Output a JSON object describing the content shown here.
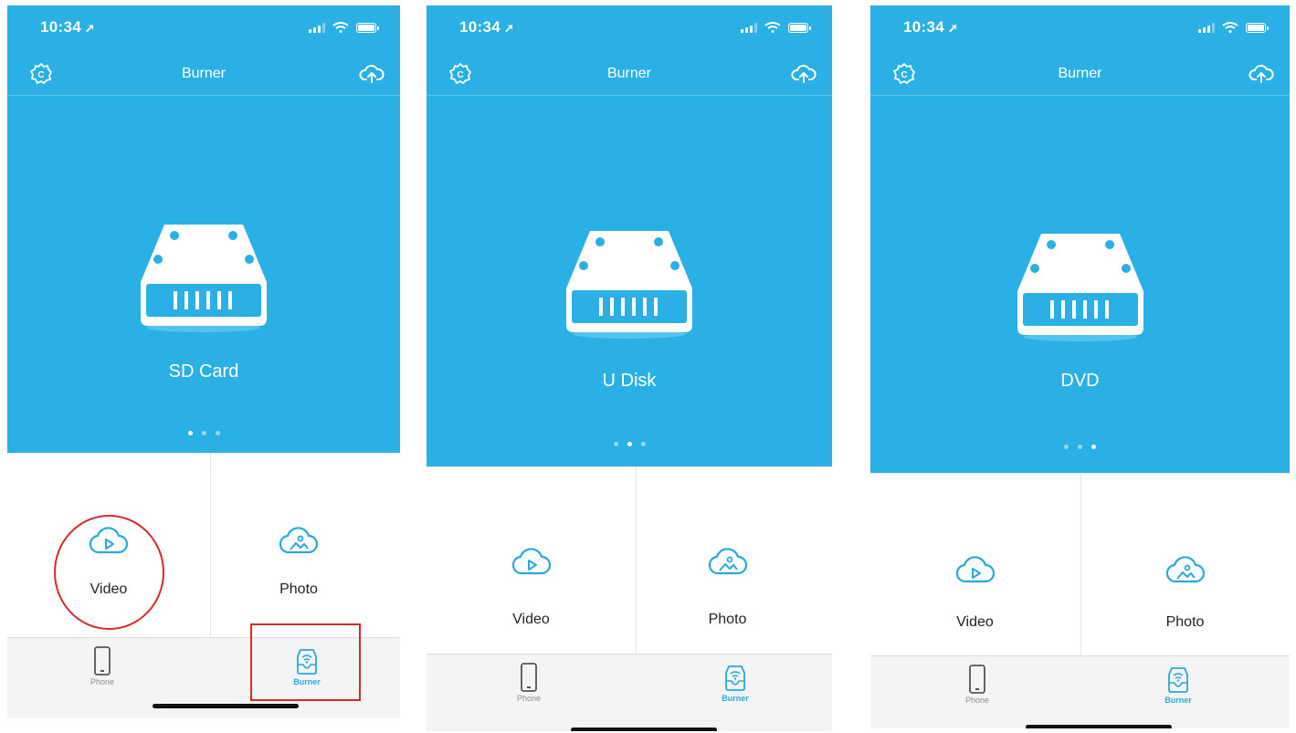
{
  "colors": {
    "accent": "#2bb0e5",
    "tab_active": "#2aa8dc",
    "annotation": "#d62a2a"
  },
  "screens": [
    {
      "status": {
        "time": "10:34"
      },
      "nav": {
        "title": "Burner",
        "left_icon": "settings-icon",
        "right_icon": "cloud-upload-icon"
      },
      "device": {
        "icon": "storage-drive-icon",
        "label": "SD Card"
      },
      "page_indicator": {
        "count": 3,
        "active": 0
      },
      "tiles": [
        {
          "label": "Video",
          "icon": "cloud-video-icon"
        },
        {
          "label": "Photo",
          "icon": "cloud-photo-icon"
        }
      ],
      "tabs": [
        {
          "label": "Phone",
          "icon": "phone-icon",
          "active": false
        },
        {
          "label": "Burner",
          "icon": "burner-icon",
          "active": true
        }
      ]
    },
    {
      "status": {
        "time": "10:34"
      },
      "nav": {
        "title": "Burner",
        "left_icon": "settings-icon",
        "right_icon": "cloud-upload-icon"
      },
      "device": {
        "icon": "storage-drive-icon",
        "label": "U Disk"
      },
      "page_indicator": {
        "count": 3,
        "active": 1
      },
      "tiles": [
        {
          "label": "Video",
          "icon": "cloud-video-icon"
        },
        {
          "label": "Photo",
          "icon": "cloud-photo-icon"
        }
      ],
      "tabs": [
        {
          "label": "Phone",
          "icon": "phone-icon",
          "active": false
        },
        {
          "label": "Burner",
          "icon": "burner-icon",
          "active": true
        }
      ]
    },
    {
      "status": {
        "time": "10:34"
      },
      "nav": {
        "title": "Burner",
        "left_icon": "settings-icon",
        "right_icon": "cloud-upload-icon"
      },
      "device": {
        "icon": "storage-drive-icon",
        "label": "DVD"
      },
      "page_indicator": {
        "count": 3,
        "active": 2
      },
      "tiles": [
        {
          "label": "Video",
          "icon": "cloud-video-icon"
        },
        {
          "label": "Photo",
          "icon": "cloud-photo-icon"
        }
      ],
      "tabs": [
        {
          "label": "Phone",
          "icon": "phone-icon",
          "active": false
        },
        {
          "label": "Burner",
          "icon": "burner-icon",
          "active": true
        }
      ]
    }
  ],
  "annotations": [
    {
      "shape": "circle",
      "target": "Video tile",
      "color": "#d62a2a"
    },
    {
      "shape": "rectangle",
      "target": "Burner tab",
      "color": "#d62a2a"
    }
  ]
}
